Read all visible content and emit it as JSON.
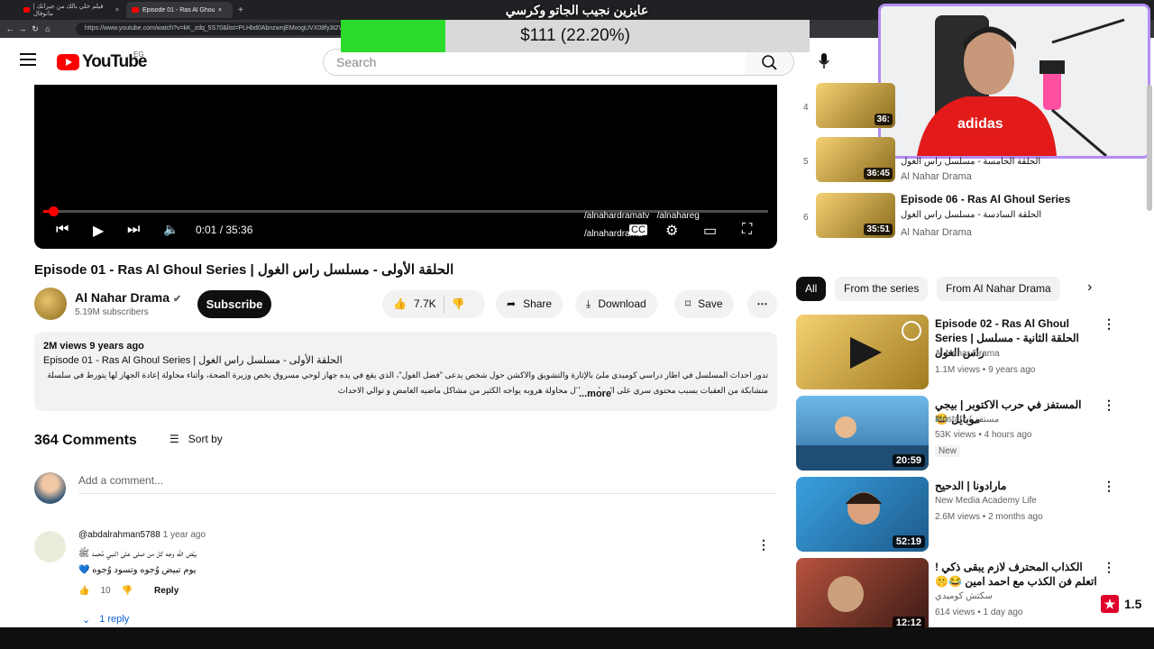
{
  "browser": {
    "tabs": [
      {
        "label": "فيلم خلي بالك من جيرانك | ماتوفال"
      },
      {
        "label": "Episode 01 - Ras Al Ghoul Series"
      }
    ],
    "url": "https://www.youtube.com/watch?v=kK_zdq_5S70&list=PLHbd0AbnzwnjEMvogUVX08fy3t2V"
  },
  "header": {
    "logo_text": "YouTube",
    "country": "EG",
    "search_placeholder": "Search"
  },
  "overlay": {
    "donation_title": "عايزين نجيب الجاتو وكرسي",
    "donation_amount": "$111 (22.20%)",
    "donation_fraction": 0.222
  },
  "player": {
    "current_time": "0:01 / 35:36",
    "progress_fraction": 0.0005,
    "social": [
      "/alnahardramatv",
      "/alnahareg",
      "/alnahardrama"
    ]
  },
  "video": {
    "title": "Episode 01 - Ras Al Ghoul Series | الحلقة الأولى - مسلسل راس الغول",
    "channel": "Al Nahar Drama",
    "subscribers": "5.19M subscribers",
    "subscribe_label": "Subscribe",
    "likes": "7.7K",
    "share_label": "Share",
    "download_label": "Download",
    "save_label": "Save",
    "description_meta": "2M views  9 years ago",
    "description_title": "Episode 01 - Ras Al Ghoul Series | الحلقة الأولى - مسلسل راس الغول",
    "description_body": "تدور احداث المسلسل في اطار دراسي كوميدي ملئ بالإثارة والتشويق والاكشن حول شخص يدعى \"فضل الغول\"، الذي يقع في يده جهاز لوحي مسروق يخص وزيرة الصحة، وأثناء محاولة إعادة الجهاز لها يتورط في سلسلة متشابكة من العقبات بسبب محتوى سري على الجهاز، وخلال محاولة هروبه يواجه الكثير من مشاكل ماضيه الغامض و توالي الاحداث",
    "more_label": "...more"
  },
  "comments": {
    "count_label": "364 Comments",
    "sort_label": "Sort by",
    "add_placeholder": "Add a comment...",
    "items": [
      {
        "author": "@abdalrahman5788",
        "time": "1 year ago",
        "line1": "يبّض الله وجه كل من صلى على النبي مُحمد ﷺ",
        "line2": "يوم تبيض وُجوه وتسود وُجوه 💙",
        "likes": "10",
        "reply_label": "Reply",
        "replies_label": "1 reply"
      }
    ]
  },
  "playlist": [
    {
      "index": "4",
      "duration": "36:",
      "title": "",
      "subtitle": "",
      "channel": ""
    },
    {
      "index": "5",
      "duration": "36:45",
      "title": "",
      "subtitle": "الحلقة الخامسة - مسلسل راس الغول",
      "channel": "Al Nahar Drama"
    },
    {
      "index": "6",
      "duration": "35:51",
      "title": "Episode 06 - Ras Al Ghoul Series",
      "subtitle": "الحلقة السادسة - مسلسل راس الغول",
      "channel": "Al Nahar Drama"
    }
  ],
  "chips": [
    "All",
    "From the series",
    "From Al Nahar Drama"
  ],
  "recommendations": [
    {
      "title": "Episode 02 - Ras Al Ghoul Series | الحلقة الثانية - مسلسل راس الغول",
      "channel": "Al Nahar Drama",
      "meta": "1.1M views • 9 years ago",
      "duration": "",
      "badge": "",
      "thumb_color": "#d9b45a"
    },
    {
      "title": "المستفز في حرب الاكتوبر | بيجي موبايل 😂",
      "channel": "Mostafz / مستفز",
      "meta": "53K views • 4 hours ago",
      "duration": "20:59",
      "badge": "New",
      "thumb_color": "#3f8fc9"
    },
    {
      "title": "مارادونا | الدحيح",
      "channel": "New Media Academy Life",
      "meta": "2.6M views • 2 months ago",
      "duration": "52:19",
      "badge": "",
      "thumb_color": "#2a7fc0"
    },
    {
      "title": "الكذاب المحترف لازم يبقى ذكي ! اتعلم فن الكذب مع احمد امين 😂🤫",
      "channel": "سكتش كوميدي",
      "meta": "614 views • 1 day ago",
      "duration": "12:12",
      "badge": "",
      "thumb_color": "#8a3a2e"
    }
  ],
  "rating": "1.5"
}
